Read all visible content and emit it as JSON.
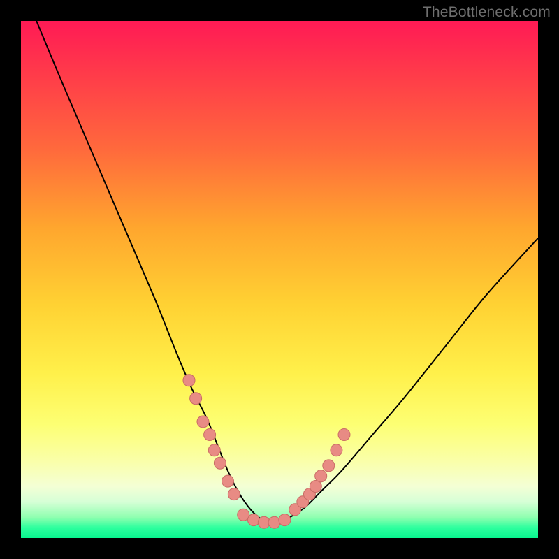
{
  "watermark": "TheBottleneck.com",
  "colors": {
    "frame": "#000000",
    "curve": "#000000",
    "dot_fill": "#e88b84",
    "dot_stroke": "#c96c65"
  },
  "chart_data": {
    "type": "line",
    "title": "",
    "xlabel": "",
    "ylabel": "",
    "xlim": [
      0,
      100
    ],
    "ylim": [
      0,
      100
    ],
    "grid": false,
    "legend": false,
    "description": "V-shaped bottleneck curve over red→yellow→green vertical gradient. Curve descends steeply from the upper-left edge, flattens to a trough around x≈45–50 near y≈3, then rises toward upper-right. Small salmon-colored data dots cluster along both arms near the trough.",
    "series": [
      {
        "name": "curve",
        "x": [
          3,
          8,
          14,
          20,
          26,
          30,
          33,
          36,
          38,
          40,
          42,
          44,
          46,
          48,
          50,
          52,
          55,
          58,
          62,
          68,
          74,
          82,
          90,
          100
        ],
        "y": [
          100,
          88,
          74,
          60,
          46,
          36,
          29,
          23,
          18,
          13,
          9,
          6,
          4,
          3,
          3,
          4,
          6,
          9,
          13,
          20,
          27,
          37,
          47,
          58
        ]
      },
      {
        "name": "dots_left_arm",
        "x": [
          32.5,
          33.8,
          35.2,
          36.5,
          37.4,
          38.5,
          40.0,
          41.2
        ],
        "y": [
          30.5,
          27.0,
          22.5,
          20.0,
          17.0,
          14.5,
          11.0,
          8.5
        ]
      },
      {
        "name": "dots_right_arm",
        "x": [
          53.0,
          54.5,
          55.8,
          57.0,
          58.0,
          59.5,
          61.0,
          62.5
        ],
        "y": [
          5.5,
          7.0,
          8.5,
          10.0,
          12.0,
          14.0,
          17.0,
          20.0
        ]
      },
      {
        "name": "dots_trough",
        "x": [
          43.0,
          45.0,
          47.0,
          49.0,
          51.0
        ],
        "y": [
          4.5,
          3.5,
          3.0,
          3.0,
          3.5
        ]
      }
    ]
  }
}
